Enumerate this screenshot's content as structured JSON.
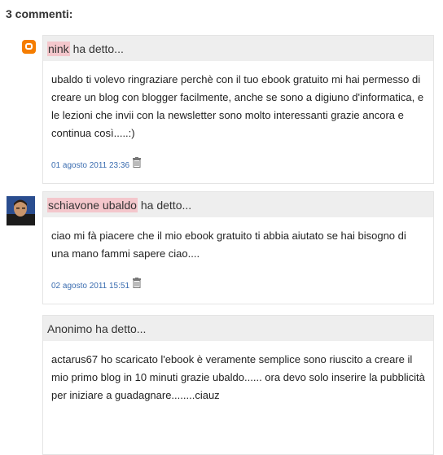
{
  "comments_heading": "3 commenti:",
  "comments": [
    {
      "author": "nink",
      "said": "ha detto...",
      "text": "ubaldo ti volevo ringraziare perchè con il tuo ebook gratuito mi hai permesso di creare un blog con blogger facilmente, anche se sono a digiuno d'informatica, e le lezioni che invii con la newsletter sono molto interessanti grazie ancora e continua così.....:)",
      "timestamp": "01 agosto 2011 23:36",
      "icon": "blogger-icon"
    },
    {
      "author": "schiavone ubaldo",
      "said": "ha detto...",
      "text": "ciao mi fà piacere che il mio ebook gratuito ti abbia aiutato se hai bisogno di una mano fammi sapere ciao....",
      "timestamp": "02 agosto 2011 15:51",
      "icon": "avatar"
    },
    {
      "author": "Anonimo",
      "said": "ha detto...",
      "text": "actarus67 ho scaricato l'ebook è veramente semplice sono riuscito a creare il mio primo blog in 10 minuti grazie ubaldo...... ora devo solo inserire la pubblicità per iniziare a guadagnare........ciauz"
    }
  ],
  "colors": {
    "link": "#3b6db0",
    "author_highlight": "#f4c7cc",
    "header_bg": "#eeeeee"
  }
}
